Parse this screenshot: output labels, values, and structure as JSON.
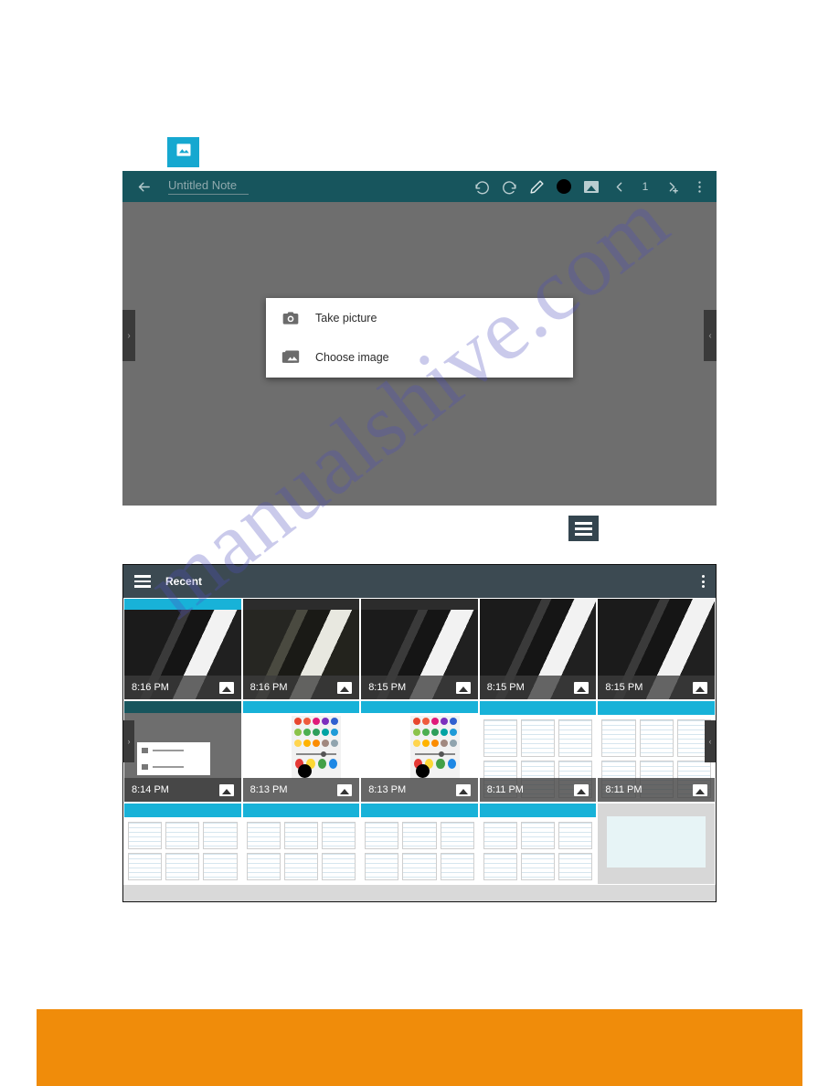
{
  "watermark": {
    "text": "manualshive.com"
  },
  "figure1": {
    "badge_icon": "image-icon",
    "toolbar": {
      "back_icon": "back-arrow-icon",
      "title": "Untitled Note",
      "undo_icon": "undo-icon",
      "redo_icon": "redo-icon",
      "pen_icon": "pen-icon",
      "color_icon": "color-swatch-icon",
      "insert_image_icon": "insert-image-icon",
      "prev_page_icon": "chevron-left-icon",
      "page_number": "1",
      "add_page_icon": "chevron-right-plus-icon",
      "overflow_icon": "overflow-menu-icon"
    },
    "left_handle": "›",
    "right_handle": "‹",
    "dialog": {
      "items": [
        {
          "icon": "camera-icon",
          "label": "Take picture"
        },
        {
          "icon": "photo-stack-icon",
          "label": "Choose image"
        }
      ]
    }
  },
  "figure2_badge": {
    "icon": "hamburger-menu-icon"
  },
  "figure2": {
    "topbar": {
      "menu_icon": "hamburger-menu-icon",
      "title": "Recent",
      "overflow_icon": "overflow-menu-icon"
    },
    "left_handle": "›",
    "right_handle": "‹",
    "grid": {
      "row1": [
        {
          "time": "8:16 PM",
          "kind": "photo",
          "type_icon": "image-icon"
        },
        {
          "time": "8:16 PM",
          "kind": "photo2",
          "type_icon": "image-icon"
        },
        {
          "time": "8:15 PM",
          "kind": "photo",
          "type_icon": "image-icon"
        },
        {
          "time": "8:15 PM",
          "kind": "photo",
          "type_icon": "image-icon"
        },
        {
          "time": "8:15 PM",
          "kind": "photo",
          "type_icon": "image-icon"
        }
      ],
      "row2": [
        {
          "time": "8:14 PM",
          "kind": "note",
          "type_icon": "image-icon"
        },
        {
          "time": "8:13 PM",
          "kind": "palette",
          "type_icon": "image-icon"
        },
        {
          "time": "8:13 PM",
          "kind": "palette",
          "type_icon": "image-icon"
        },
        {
          "time": "8:11 PM",
          "kind": "template",
          "type_icon": "image-icon"
        },
        {
          "time": "8:11 PM",
          "kind": "template",
          "type_icon": "image-icon"
        }
      ],
      "row3": [
        {
          "time": "",
          "kind": "template",
          "type_icon": ""
        },
        {
          "time": "",
          "kind": "template",
          "type_icon": ""
        },
        {
          "time": "",
          "kind": "template",
          "type_icon": ""
        },
        {
          "time": "",
          "kind": "template",
          "type_icon": ""
        },
        {
          "time": "",
          "kind": "template",
          "type_icon": ""
        }
      ]
    }
  },
  "colors": {
    "app_bar_teal": "#17555d",
    "accent_cyan": "#16a8d0",
    "picker_bar": "#3c4a52",
    "canvas_gray": "#6e6e6e",
    "orange_bar": "#f08c0a"
  }
}
